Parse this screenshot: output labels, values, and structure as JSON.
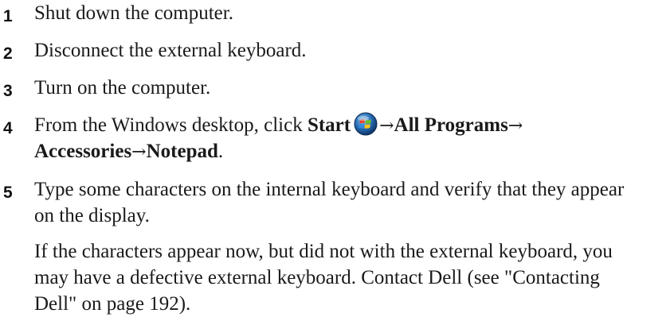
{
  "steps": [
    {
      "number": "1",
      "text": "Shut down the computer."
    },
    {
      "number": "2",
      "text": "Disconnect the external keyboard."
    },
    {
      "number": "3",
      "text": "Turn on the computer."
    },
    {
      "number": "4",
      "prefix": "From the Windows desktop, click ",
      "start_label": "Start",
      "arrow": "→",
      "all_programs": "All Programs",
      "accessories": "Accessories",
      "notepad": "Notepad",
      "suffix": "."
    },
    {
      "number": "5",
      "line1": "Type some characters on the internal keyboard and verify that they appear",
      "line2": "on the display."
    }
  ],
  "note": {
    "line1": "If the characters appear now, but did not with the external keyboard, you",
    "line2": "may have a defective external keyboard. Contact Dell (see \"Contacting",
    "line3": "Dell\" on page 192)."
  },
  "icons": {
    "start_icon": "windows-start-orb-icon"
  }
}
